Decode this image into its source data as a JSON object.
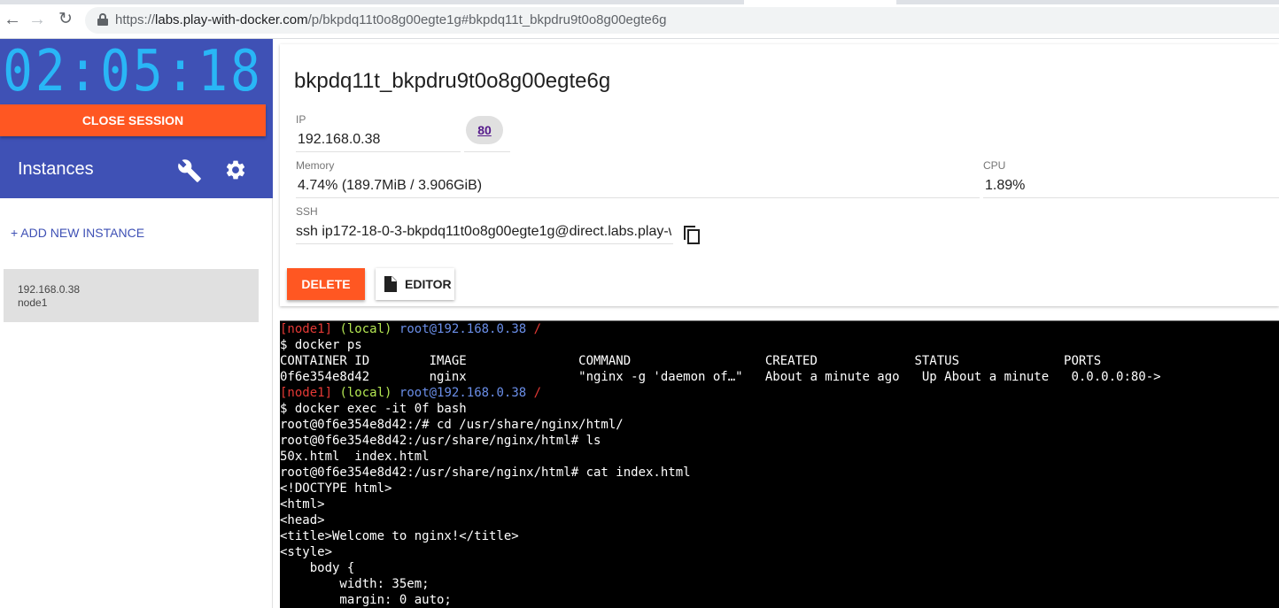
{
  "browser": {
    "url_prefix": "https://",
    "url_host": "labs.play-with-docker.com",
    "url_rest": "/p/bkpdq11t0o8g00egte1g#bkpdq11t_bkpdru9t0o8g00egte6g"
  },
  "sidebar": {
    "timer": "02:05:18",
    "close_session_label": "CLOSE SESSION",
    "instances_title": "Instances",
    "add_instance_label": "+ ADD NEW INSTANCE",
    "instances": [
      {
        "ip": "192.168.0.38",
        "name": "node1"
      }
    ]
  },
  "instance": {
    "title": "bkpdq11t_bkpdru9t0o8g00egte6g",
    "ip_label": "IP",
    "ip_value": "192.168.0.38",
    "port": "80",
    "memory_label": "Memory",
    "memory_value": "4.74% (189.7MiB / 3.906GiB)",
    "cpu_label": "CPU",
    "cpu_value": "1.89%",
    "ssh_label": "SSH",
    "ssh_value": "ssh ip172-18-0-3-bkpdq11t0o8g00egte1g@direct.labs.play-w",
    "delete_label": "DELETE",
    "editor_label": "EDITOR"
  },
  "terminal": {
    "prompt_node": "[node1]",
    "prompt_local": "(local)",
    "prompt_host": "root@192.168.0.38",
    "prompt_dir": "/",
    "lines": [
      "$ docker ps",
      "CONTAINER ID        IMAGE               COMMAND                  CREATED             STATUS              PORTS",
      "0f6e354e8d42        nginx               \"nginx -g 'daemon of…\"   About a minute ago   Up About a minute   0.0.0.0:80->",
      "$ docker exec -it 0f bash",
      "root@0f6e354e8d42:/# cd /usr/share/nginx/html/",
      "root@0f6e354e8d42:/usr/share/nginx/html# ls",
      "50x.html  index.html",
      "root@0f6e354e8d42:/usr/share/nginx/html# cat index.html",
      "<!DOCTYPE html>",
      "<html>",
      "<head>",
      "<title>Welcome to nginx!</title>",
      "<style>",
      "    body {",
      "        width: 35em;",
      "        margin: 0 auto;"
    ]
  },
  "colors": {
    "sidebar_blue": "#3f51b5",
    "timer_cyan": "#29b6f6",
    "accent_orange": "#ff5722",
    "prompt_red": "#e53935",
    "prompt_green": "#b5e853",
    "prompt_blue": "#6a8ee8"
  },
  "icons": [
    "back-icon",
    "forward-icon",
    "reload-icon",
    "lock-icon",
    "wrench-icon",
    "gear-icon",
    "copy-icon",
    "file-icon"
  ]
}
